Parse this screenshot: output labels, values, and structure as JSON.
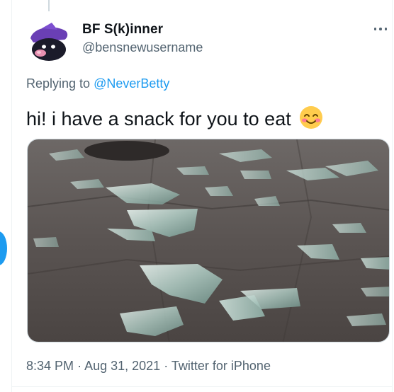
{
  "tweet": {
    "display_name": "BF S(k)inner",
    "handle": "@bensnewusername",
    "replying_prefix": "Replying to",
    "replying_to": "@NeverBetty",
    "text": "hi! i have a snack for you to eat",
    "emoji": "smiling-face-with-smiling-eyes-emoji",
    "image": "broken-glass-shards-on-pavement",
    "time": "8:34 PM",
    "separator": "·",
    "date": "Aug 31, 2021",
    "source": "Twitter for iPhone"
  },
  "colors": {
    "text": "#0f1419",
    "secondary": "#536471",
    "link": "#1d9bf0",
    "border": "#cfd9de",
    "avatar_purple": "#6a3fb5"
  }
}
